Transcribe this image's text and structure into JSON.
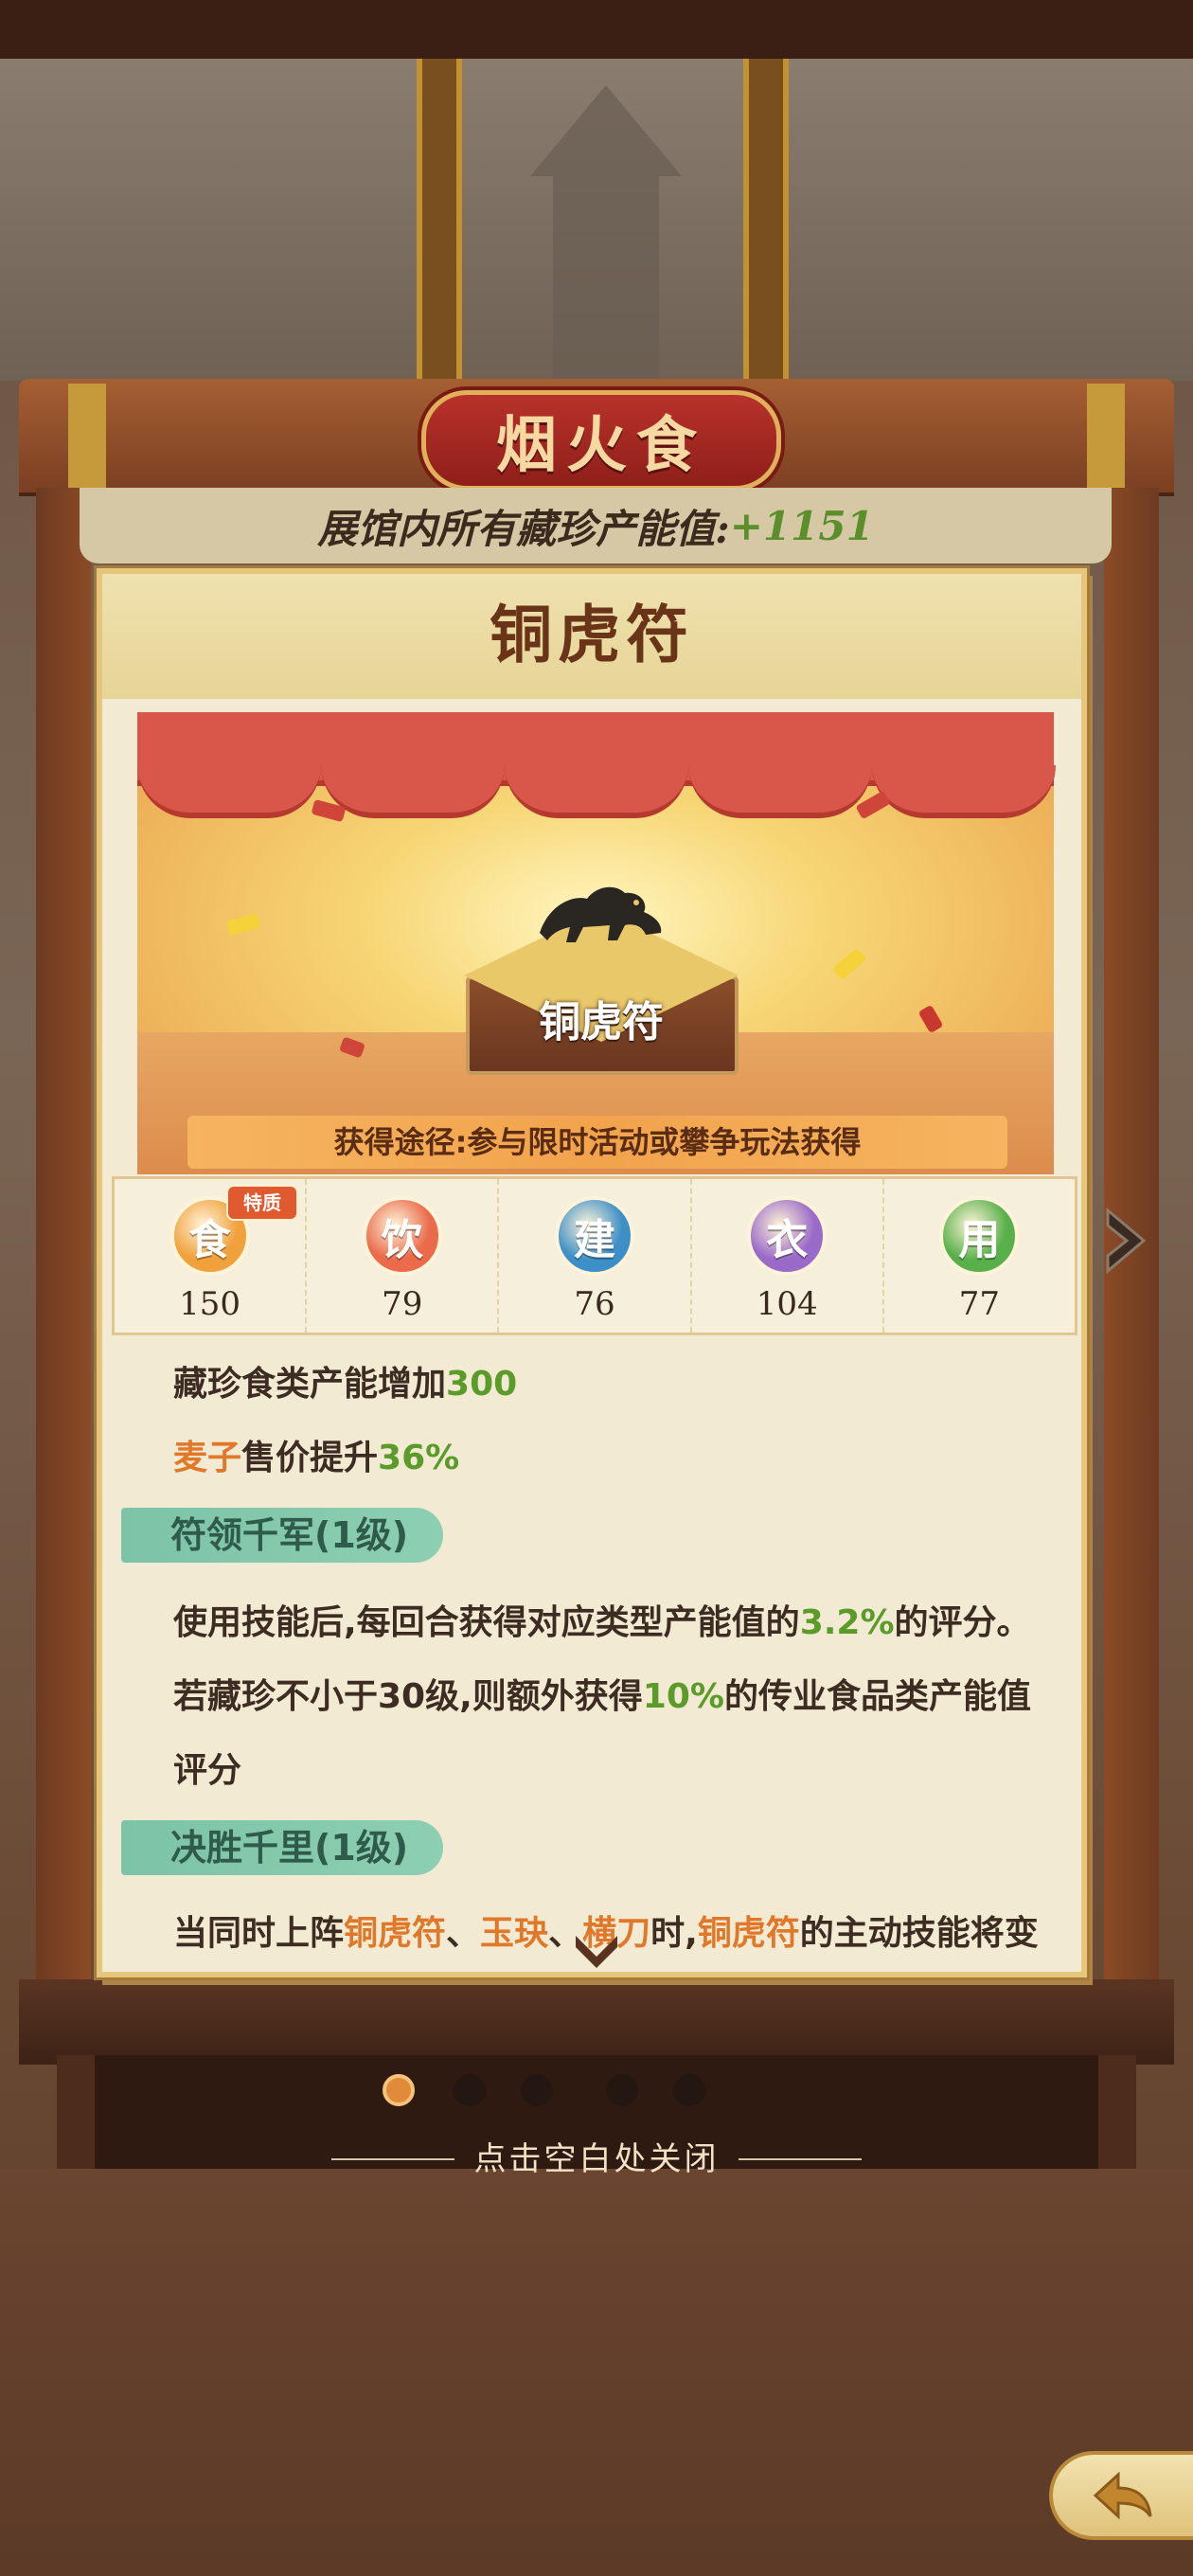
{
  "hall": {
    "title": "烟火食",
    "capacity_label": "展馆内所有藏珍产能值:",
    "capacity_value": "+1151"
  },
  "relic": {
    "title": "铜虎符",
    "stage_name": "铜虎符",
    "source": "获得途径:参与限时活动或攀争玩法获得"
  },
  "stats": [
    {
      "glyph": "食",
      "value": "150",
      "tag": "特质",
      "color": "#f0a13c"
    },
    {
      "glyph": "饮",
      "value": "79",
      "color": "#ea6a4a"
    },
    {
      "glyph": "建",
      "value": "76",
      "color": "#3d8fc7"
    },
    {
      "glyph": "衣",
      "value": "104",
      "color": "#9a6ac8"
    },
    {
      "glyph": "用",
      "value": "77",
      "color": "#58b04a"
    }
  ],
  "effects": {
    "line1_text": "藏珍食类产能增加",
    "line1_value": "300",
    "line2_item": "麦子",
    "line2_text": "售价提升",
    "line2_value": "36%"
  },
  "skills": [
    {
      "name": "符领千军(1级)",
      "line1_a": "使用技能后,每回合获得对应类型产能值的",
      "line1_value": "3.2%",
      "line1_b": "的评分。",
      "line2_a": "若藏珍不小于30级,则额外获得",
      "line2_value": "10%",
      "line2_b": "的传业食品类产能值",
      "line3": "评分"
    },
    {
      "name": "决胜千里(1级)",
      "line1_a": "当同时上阵",
      "item1": "铜虎符",
      "sep1": "、",
      "item2": "玉玦",
      "sep2": "、",
      "item3": "横刀",
      "line1_b": "时,",
      "item4": "铜虎符",
      "line1_c": "的主动技能将变"
    }
  ],
  "pagination": {
    "current": 1,
    "total": 5
  },
  "close_hint": "点击空白处关闭",
  "icons": [
    "scroll-down-icon",
    "next-page-icon",
    "back-icon",
    "tiger-relic-icon"
  ]
}
